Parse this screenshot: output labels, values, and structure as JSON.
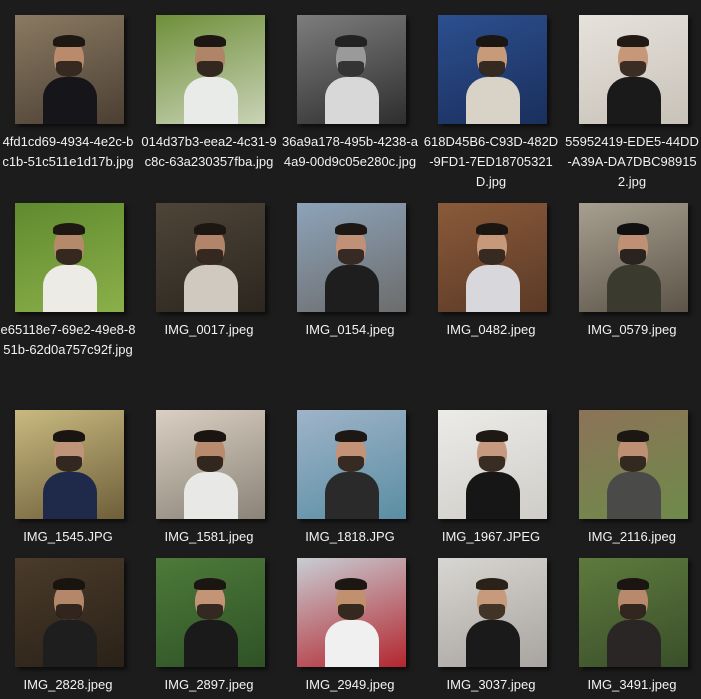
{
  "window": {
    "view": "Large icons"
  },
  "files": [
    {
      "name": "4fd1cd69-4934-4e2c-bc1b-51c511e1d17b.jpg",
      "icon": "photo-thumbnail-icon",
      "bg": "#8a7a62",
      "bg2": "#4b3f33",
      "skin": "#b98b6c",
      "hair": "#1e1812",
      "shirt": "#15151a"
    },
    {
      "name": "014d37b3-eea2-4c31-9c8c-63a230357fba.jpg",
      "icon": "photo-thumbnail-icon",
      "bg": "#6f8f3a",
      "bg2": "#c9d3b6",
      "skin": "#b08466",
      "hair": "#1c1713",
      "shirt": "#e9ebe8"
    },
    {
      "name": "36a9a178-495b-4238-a4a9-00d9c05e280c.jpg",
      "icon": "photo-thumbnail-icon",
      "bg": "#7d7d7d",
      "bg2": "#2e2e2e",
      "skin": "#9a9a9a",
      "hair": "#222222",
      "shirt": "#d8d8d8"
    },
    {
      "name": "618D45B6-C93D-482D-9FD1-7ED18705321D.jpg",
      "icon": "photo-thumbnail-icon",
      "bg": "#2c4f8f",
      "bg2": "#1a2f5c",
      "skin": "#c79a7a",
      "hair": "#1b1612",
      "shirt": "#d9d2c6"
    },
    {
      "name": "55952419-EDE5-44DD-A39A-DA7DBC989152.jpg",
      "icon": "photo-thumbnail-icon",
      "bg": "#e6e2dc",
      "bg2": "#c8c2b8",
      "skin": "#c7977a",
      "hair": "#221a14",
      "shirt": "#1a1a1a"
    },
    {
      "name": "e65118e7-69e2-49e8-851b-62d0a757c92f.jpg",
      "icon": "photo-thumbnail-icon",
      "bg": "#5f8a2e",
      "bg2": "#8bb04a",
      "skin": "#b48a6a",
      "hair": "#1e1712",
      "shirt": "#ecebe6"
    },
    {
      "name": "IMG_0017.jpeg",
      "icon": "photo-thumbnail-icon",
      "bg": "#4e4538",
      "bg2": "#2c261f",
      "skin": "#b2856a",
      "hair": "#1d1713",
      "shirt": "#cfc9c0"
    },
    {
      "name": "IMG_0154.jpeg",
      "icon": "photo-thumbnail-icon",
      "bg": "#8da3b9",
      "bg2": "#6c6c6c",
      "skin": "#c09077",
      "hair": "#1e1814",
      "shirt": "#1e1e1e"
    },
    {
      "name": "IMG_0482.jpeg",
      "icon": "photo-thumbnail-icon",
      "bg": "#8a5a3a",
      "bg2": "#5b3a26",
      "skin": "#c8987a",
      "hair": "#1c1612",
      "shirt": "#d7d7dc"
    },
    {
      "name": "IMG_0579.jpeg",
      "icon": "photo-thumbnail-icon",
      "bg": "#a7a090",
      "bg2": "#5c5448",
      "skin": "#bf9074",
      "hair": "#111111",
      "shirt": "#3a3a2e"
    },
    {
      "name": "IMG_1545.JPG",
      "icon": "photo-thumbnail-icon",
      "bg": "#c9b980",
      "bg2": "#6e5f3a",
      "skin": "#c09479",
      "hair": "#1a1511",
      "shirt": "#1f2a4a"
    },
    {
      "name": "IMG_1581.jpeg",
      "icon": "photo-thumbnail-icon",
      "bg": "#d9cfc2",
      "bg2": "#8b8378",
      "skin": "#b88b6e",
      "hair": "#1a1511",
      "shirt": "#e8e8e6"
    },
    {
      "name": "IMG_1818.JPG",
      "icon": "photo-thumbnail-icon",
      "bg": "#9fb3c8",
      "bg2": "#5a8ea3",
      "skin": "#c49276",
      "hair": "#1d1814",
      "shirt": "#2a2a2a"
    },
    {
      "name": "IMG_1967.JPEG",
      "icon": "photo-thumbnail-icon",
      "bg": "#ecebe8",
      "bg2": "#cfcdc8",
      "skin": "#c69a80",
      "hair": "#201913",
      "shirt": "#161616"
    },
    {
      "name": "IMG_2116.jpeg",
      "icon": "photo-thumbnail-icon",
      "bg": "#8c7358",
      "bg2": "#6e8a4a",
      "skin": "#bd9073",
      "hair": "#1c1712",
      "shirt": "#4a4a48"
    },
    {
      "name": "IMG_2828.jpeg",
      "icon": "photo-thumbnail-icon",
      "bg": "#4a3b2a",
      "bg2": "#2a2118",
      "skin": "#b4876a",
      "hair": "#1a1410",
      "shirt": "#1e1e1e"
    },
    {
      "name": "IMG_2897.jpeg",
      "icon": "photo-thumbnail-icon",
      "bg": "#4d7a3a",
      "bg2": "#2f5226",
      "skin": "#c39476",
      "hair": "#1b1612",
      "shirt": "#1a1a1a"
    },
    {
      "name": "IMG_2949.jpeg",
      "icon": "photo-thumbnail-icon",
      "bg": "#c8cdd4",
      "bg2": "#b3262e",
      "skin": "#c0906f",
      "hair": "#1c1712",
      "shirt": "#f0f0f0"
    },
    {
      "name": "IMG_3037.jpeg",
      "icon": "photo-thumbnail-icon",
      "bg": "#d8d6d2",
      "bg2": "#a8a4a0",
      "skin": "#c89a7c",
      "hair": "#2a2119",
      "shirt": "#1a1a1a"
    },
    {
      "name": "IMG_3491.jpeg",
      "icon": "photo-thumbnail-icon",
      "bg": "#5e7a3e",
      "bg2": "#3a4f2a",
      "skin": "#b8896c",
      "hair": "#1a1511",
      "shirt": "#2a2626"
    }
  ]
}
